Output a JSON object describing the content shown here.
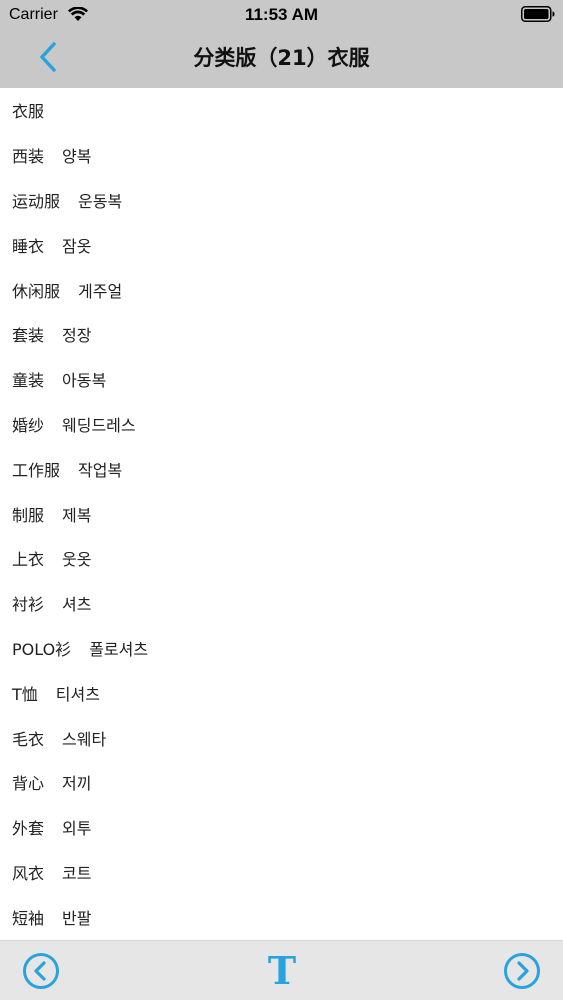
{
  "status_bar": {
    "carrier": "Carrier",
    "time": "11:53 AM"
  },
  "nav": {
    "title": "分类版（21）衣服",
    "back_icon": "chevron-left-icon"
  },
  "items": [
    {
      "zh": "衣服",
      "ko": ""
    },
    {
      "zh": "西装",
      "ko": "양복"
    },
    {
      "zh": "运动服",
      "ko": "운동복"
    },
    {
      "zh": "睡衣",
      "ko": "잠옷"
    },
    {
      "zh": "休闲服",
      "ko": "게주얼"
    },
    {
      "zh": "套装",
      "ko": "정장"
    },
    {
      "zh": "童装",
      "ko": "아동복"
    },
    {
      "zh": "婚纱",
      "ko": "웨딩드레스"
    },
    {
      "zh": "工作服",
      "ko": "작업복"
    },
    {
      "zh": "制服",
      "ko": "제복"
    },
    {
      "zh": "上衣",
      "ko": "웃옷"
    },
    {
      "zh": "衬衫",
      "ko": "셔츠"
    },
    {
      "zh": "POLO衫",
      "ko": "폴로셔츠"
    },
    {
      "zh": "T恤",
      "ko": "티셔츠"
    },
    {
      "zh": "毛衣",
      "ko": "스웨타"
    },
    {
      "zh": "背心",
      "ko": "저끼"
    },
    {
      "zh": "外套",
      "ko": "외투"
    },
    {
      "zh": "风衣",
      "ko": "코트"
    },
    {
      "zh": "短袖",
      "ko": "반팔"
    }
  ],
  "toolbar": {
    "prev_icon": "circle-chevron-left-icon",
    "font_label": "T",
    "next_icon": "circle-chevron-right-icon"
  },
  "colors": {
    "accent": "#29a3e0",
    "header_bg": "#c8c8c8",
    "toolbar_bg": "#e6e6e6"
  }
}
